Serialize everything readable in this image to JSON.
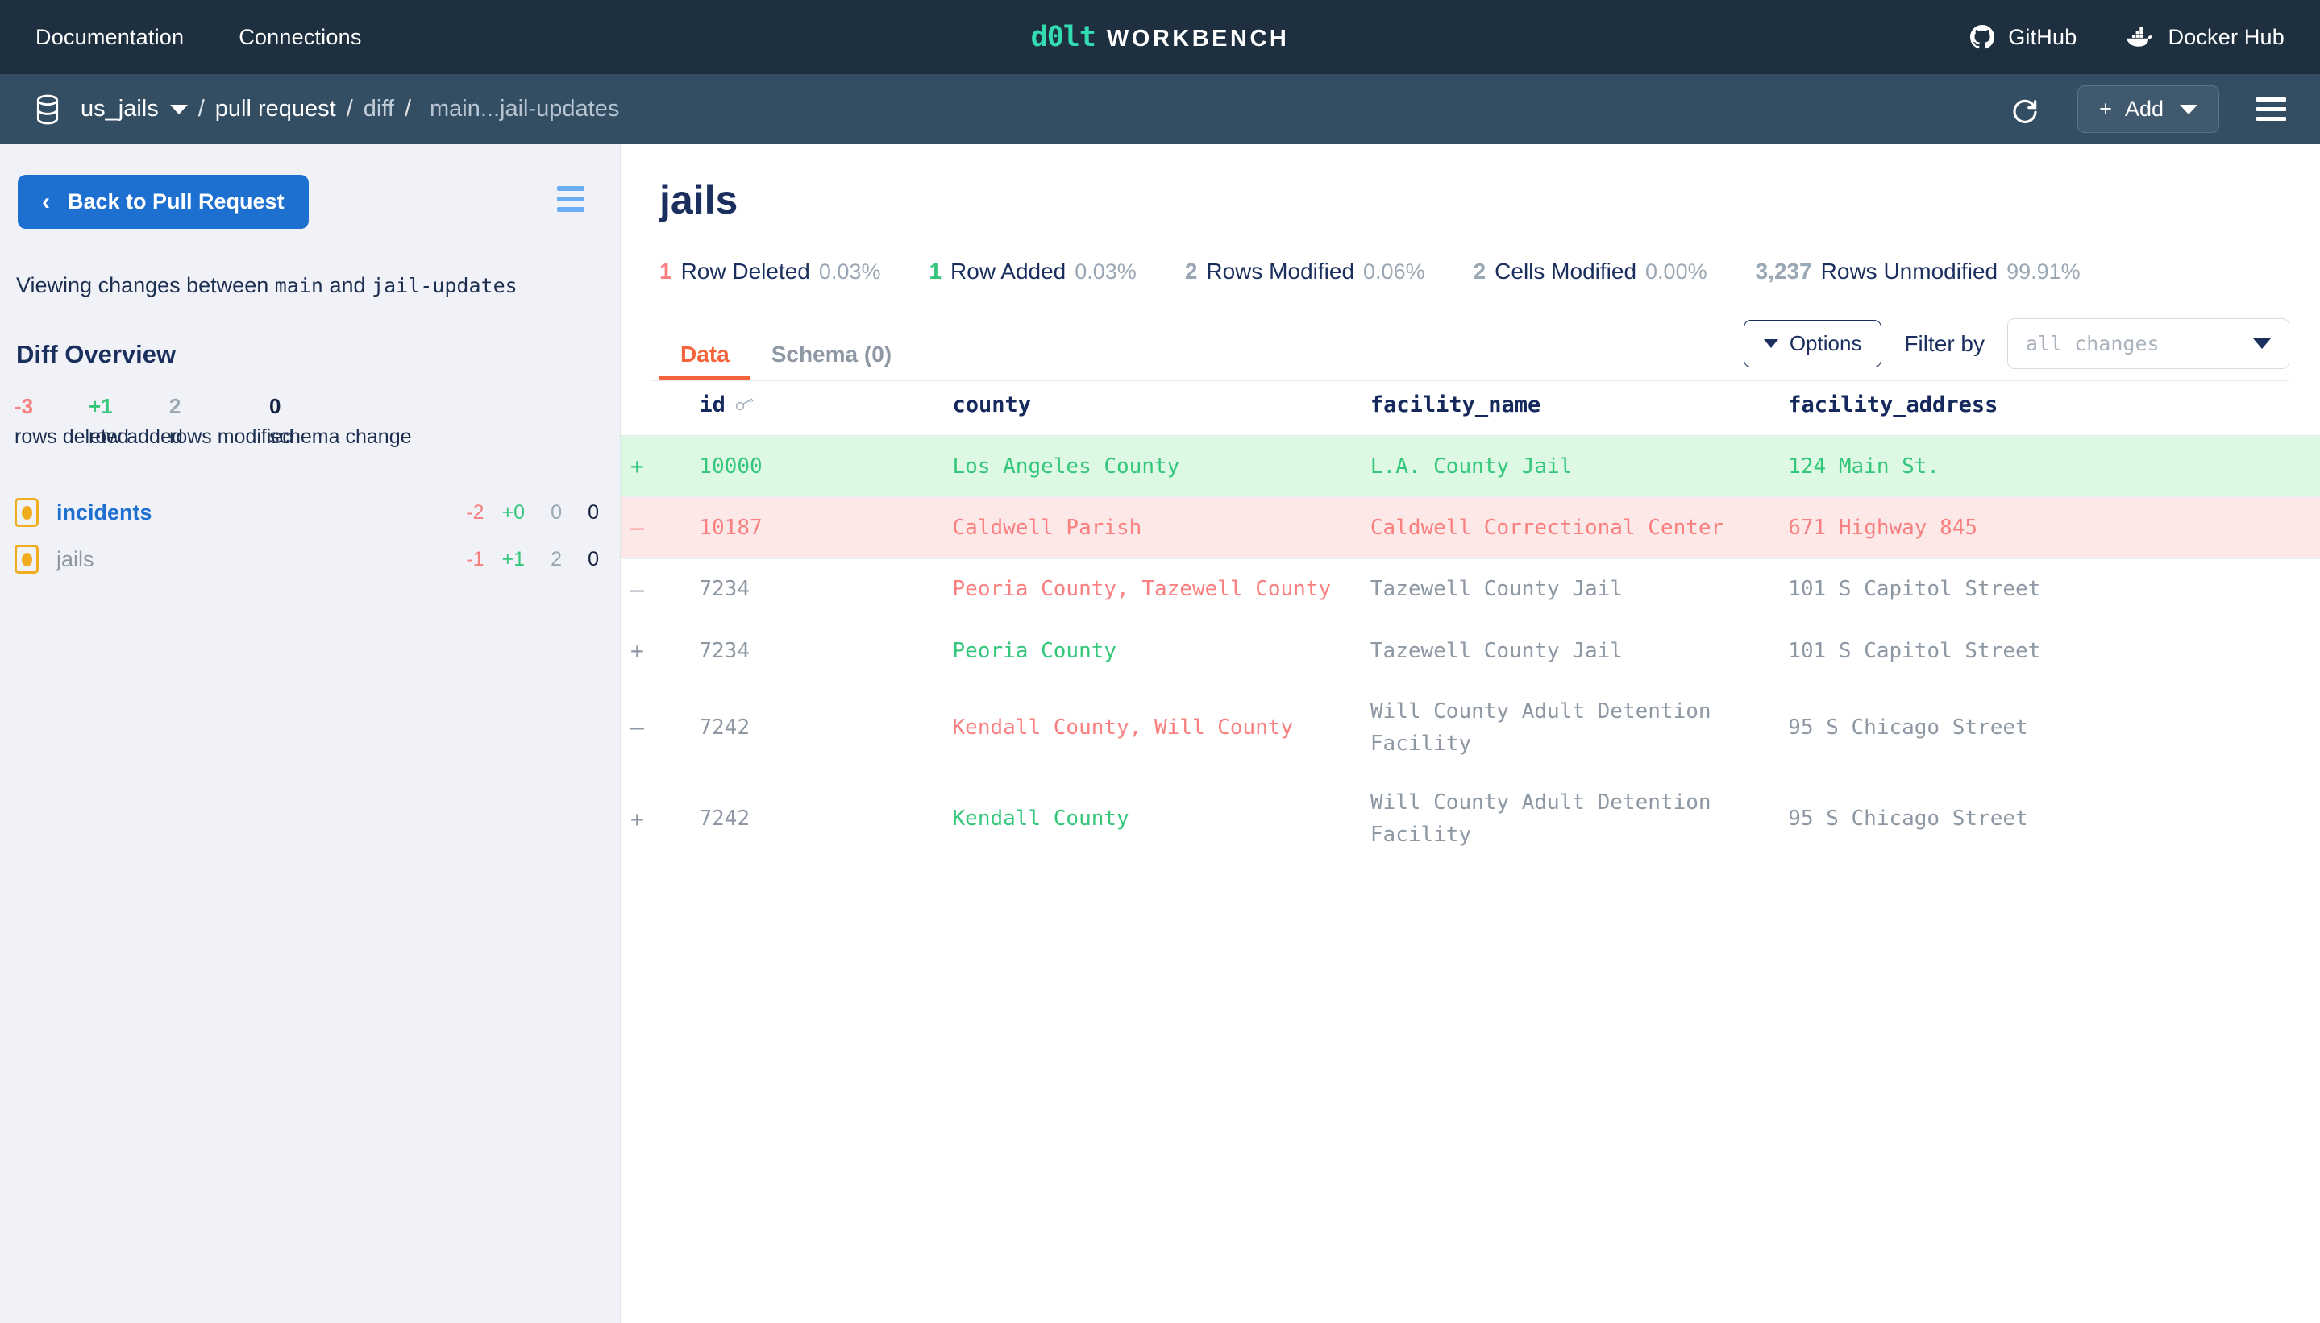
{
  "topnav": {
    "links": [
      {
        "label": "Documentation",
        "icon": ""
      },
      {
        "label": "Connections",
        "icon": ""
      }
    ],
    "brand": {
      "mark": "d0lt",
      "word": "WORKBENCH"
    },
    "right": [
      {
        "label": "GitHub",
        "icon": "github-icon"
      },
      {
        "label": "Docker Hub",
        "icon": "docker-icon"
      }
    ]
  },
  "breadcrumb": {
    "db_icon": "database-icon",
    "database": "us_jails",
    "items": [
      "pull request",
      "diff"
    ],
    "current": "main...jail-updates",
    "separator": "/",
    "refresh_icon": "refresh-icon",
    "add_label": "Add",
    "add_plus": "+",
    "menu_icon": "hamburger-icon"
  },
  "sidebar": {
    "back_label": "Back to Pull Request",
    "back_chevron": "‹",
    "panel_toggle_icon": "hamburger-icon",
    "viewing_prefix": "Viewing changes between",
    "from_branch": "main",
    "viewing_join": "and",
    "to_branch": "jail-updates",
    "overview_title": "Diff Overview",
    "stats": [
      {
        "value": "-3",
        "label": "rows deleted",
        "kind": "deleted"
      },
      {
        "value": "+1",
        "label": "row added",
        "kind": "added"
      },
      {
        "value": "2",
        "label": "rows modified",
        "kind": "modified"
      },
      {
        "value": "0",
        "label": "schema change",
        "kind": "zero"
      }
    ],
    "tables": [
      {
        "name": "incidents",
        "active": true,
        "deleted": "-2",
        "added": "+0",
        "modified": "0",
        "schema": "0"
      },
      {
        "name": "jails",
        "active": false,
        "deleted": "-1",
        "added": "+1",
        "modified": "2",
        "schema": "0"
      }
    ]
  },
  "main": {
    "title": "jails",
    "stats": [
      {
        "num": "1",
        "text": "Row Deleted",
        "pct": "0.03%",
        "kind": "deleted"
      },
      {
        "num": "1",
        "text": "Row Added",
        "pct": "0.03%",
        "kind": "added"
      },
      {
        "num": "2",
        "text": "Rows Modified",
        "pct": "0.06%",
        "kind": "modified"
      },
      {
        "num": "2",
        "text": "Cells Modified",
        "pct": "0.00%",
        "kind": "modified"
      },
      {
        "num": "3,237",
        "text": "Rows Unmodified",
        "pct": "99.91%",
        "kind": "modified"
      }
    ],
    "tabs": [
      {
        "label": "Data",
        "active": true
      },
      {
        "label": "Schema (0)",
        "active": false
      }
    ],
    "options_label": "Options",
    "filter_label": "Filter by",
    "filter_value": "all changes",
    "table": {
      "columns": [
        {
          "name": "id",
          "icon": "key-icon"
        },
        {
          "name": "county",
          "icon": ""
        },
        {
          "name": "facility_name",
          "icon": ""
        },
        {
          "name": "facility_address",
          "icon": ""
        }
      ],
      "rows": [
        {
          "mark": "+",
          "row_kind": "added",
          "cells": [
            {
              "value": "10000",
              "kind": "added"
            },
            {
              "value": "Los Angeles County",
              "kind": "added"
            },
            {
              "value": "L.A. County Jail",
              "kind": "added"
            },
            {
              "value": "124 Main St.",
              "kind": "added"
            }
          ]
        },
        {
          "mark": "–",
          "row_kind": "deleted",
          "cells": [
            {
              "value": "10187",
              "kind": "deleted"
            },
            {
              "value": "Caldwell Parish",
              "kind": "deleted"
            },
            {
              "value": "Caldwell Correctional Center",
              "kind": "deleted"
            },
            {
              "value": "671 Highway 845",
              "kind": "deleted"
            }
          ]
        },
        {
          "mark": "–",
          "row_kind": "modified",
          "cells": [
            {
              "value": "7234",
              "kind": "same"
            },
            {
              "value": "Peoria County, Tazewell County",
              "kind": "deleted"
            },
            {
              "value": "Tazewell County Jail",
              "kind": "same"
            },
            {
              "value": "101 S Capitol Street",
              "kind": "same"
            }
          ]
        },
        {
          "mark": "+",
          "row_kind": "modified",
          "cells": [
            {
              "value": "7234",
              "kind": "same"
            },
            {
              "value": "Peoria County",
              "kind": "added"
            },
            {
              "value": "Tazewell County Jail",
              "kind": "same"
            },
            {
              "value": "101 S Capitol Street",
              "kind": "same"
            }
          ]
        },
        {
          "mark": "–",
          "row_kind": "modified",
          "cells": [
            {
              "value": "7242",
              "kind": "same"
            },
            {
              "value": "Kendall County, Will County",
              "kind": "deleted"
            },
            {
              "value": "Will County Adult Detention Facility",
              "kind": "same"
            },
            {
              "value": "95 S Chicago Street",
              "kind": "same"
            }
          ]
        },
        {
          "mark": "+",
          "row_kind": "modified",
          "cells": [
            {
              "value": "7242",
              "kind": "same"
            },
            {
              "value": "Kendall County",
              "kind": "added"
            },
            {
              "value": "Will County Adult Detention Facility",
              "kind": "same"
            },
            {
              "value": "95 S Chicago Street",
              "kind": "same"
            }
          ]
        }
      ]
    }
  },
  "colors": {
    "nav_bg": "#1e3040",
    "crumb_bg": "#334d63",
    "brand_teal": "#32dbb0",
    "accent_orange": "#f4633a",
    "blue": "#1d6fd0",
    "added": "#34c77b",
    "deleted": "#f98080",
    "added_bg": "#ddf8e3",
    "deleted_bg": "#fde8e8",
    "muted": "#8d98a4",
    "navy": "#1b2f5e",
    "table_icon": "#f0ad1f"
  }
}
